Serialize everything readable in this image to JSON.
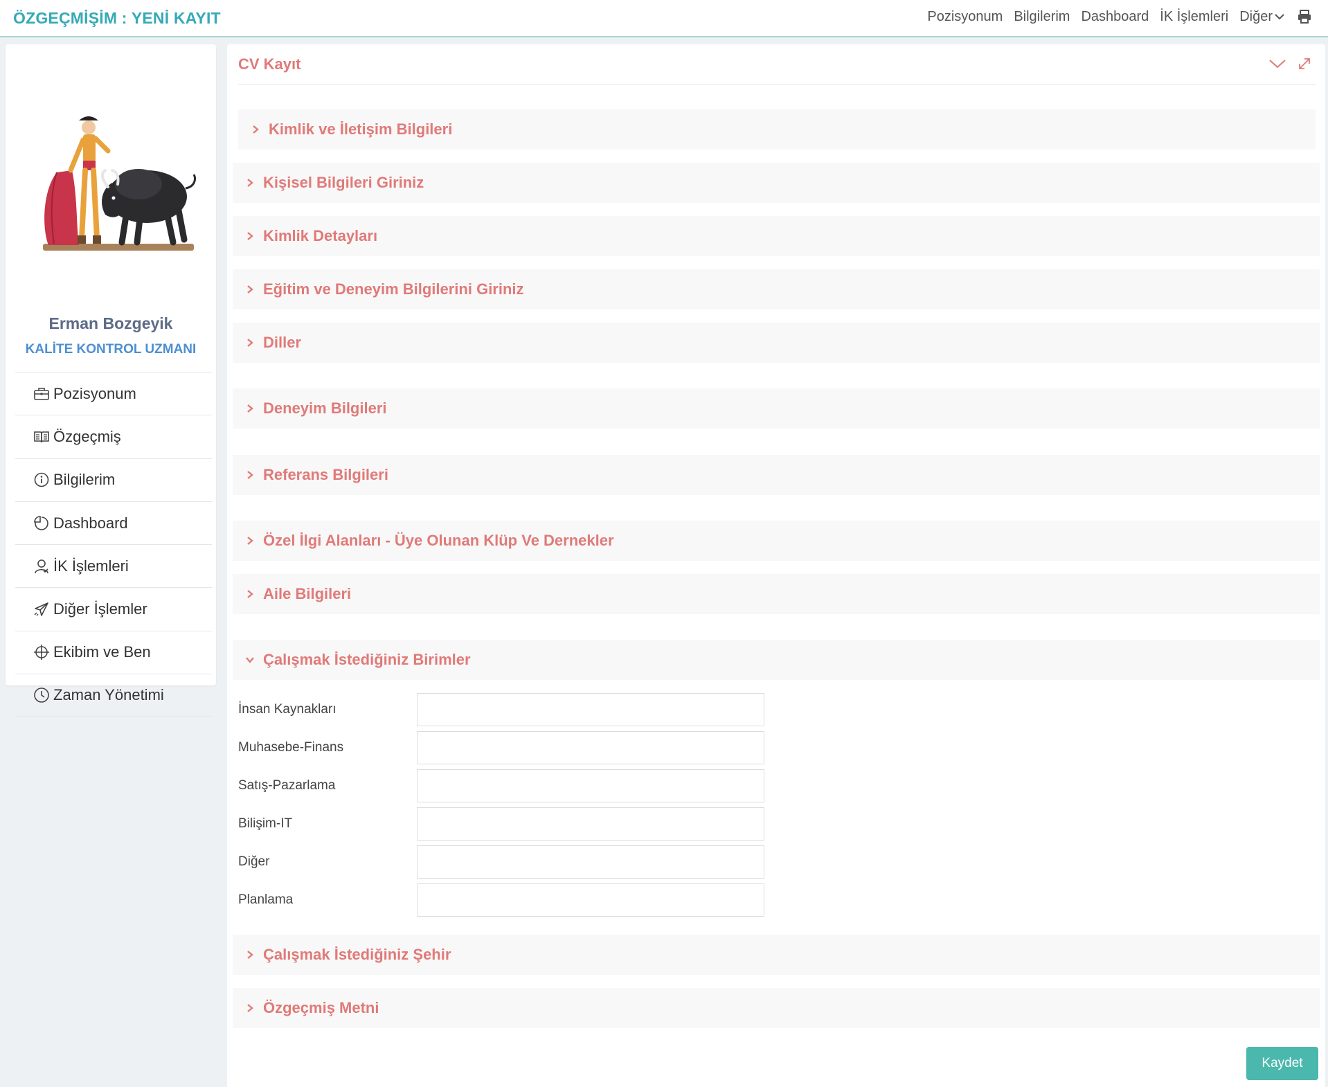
{
  "header": {
    "brand": "ÖZGEÇMİŞİM : YENİ KAYIT",
    "nav": [
      "Pozisyonum",
      "Bilgilerim",
      "Dashboard",
      "İK İşlemleri"
    ],
    "more_label": "Diğer",
    "print_icon": "printer-icon"
  },
  "colors": {
    "brand": "#36a9b7",
    "accent": "#e07a78",
    "user_name": "#5c6b87",
    "user_title": "#4d8fd0",
    "save_button": "#4bb8ad"
  },
  "profile": {
    "name": "Erman Bozgeyik",
    "title": "KALİTE KONTROL UZMANI",
    "avatar": "matador-bull-illustration"
  },
  "sidebar": {
    "items": [
      {
        "label": "Pozisyonum",
        "icon": "briefcase-icon"
      },
      {
        "label": "Özgeçmiş",
        "icon": "book-icon"
      },
      {
        "label": "Bilgilerim",
        "icon": "info-icon"
      },
      {
        "label": "Dashboard",
        "icon": "pie-chart-icon"
      },
      {
        "label": "İK İşlemleri",
        "icon": "user-icon"
      },
      {
        "label": "Diğer İşlemler",
        "icon": "plane-icon"
      },
      {
        "label": "Ekibim ve Ben",
        "icon": "target-icon"
      },
      {
        "label": "Zaman Yönetimi",
        "icon": "clock-icon"
      }
    ]
  },
  "panel": {
    "title": "CV Kayıt",
    "tools": [
      "collapse-icon",
      "expand-icon"
    ]
  },
  "sections": [
    {
      "label": "Kimlik ve İletişim Bilgileri",
      "expanded": false
    },
    {
      "label": "Kişisel Bilgileri Giriniz",
      "expanded": false
    },
    {
      "label": "Kimlik Detayları",
      "expanded": false
    },
    {
      "label": "Eğitim ve Deneyim Bilgilerini Giriniz",
      "expanded": false
    },
    {
      "label": "Diller",
      "expanded": false
    },
    {
      "label": "Deneyim Bilgileri",
      "expanded": false
    },
    {
      "label": "Referans Bilgileri",
      "expanded": false
    },
    {
      "label": "Özel İlgi Alanları - Üye Olunan Klüp Ve Dernekler",
      "expanded": false
    },
    {
      "label": "Aile Bilgileri",
      "expanded": false
    },
    {
      "label": "Çalışmak İstediğiniz Birimler",
      "expanded": true
    },
    {
      "label": "Çalışmak İstediğiniz Şehir",
      "expanded": false
    },
    {
      "label": "Özgeçmiş Metni",
      "expanded": false
    }
  ],
  "units_form": {
    "fields": [
      {
        "label": "İnsan Kaynakları",
        "value": ""
      },
      {
        "label": "Muhasebe-Finans",
        "value": ""
      },
      {
        "label": "Satış-Pazarlama",
        "value": ""
      },
      {
        "label": "Bilişim-IT",
        "value": ""
      },
      {
        "label": "Diğer",
        "value": ""
      },
      {
        "label": "Planlama",
        "value": ""
      }
    ]
  },
  "actions": {
    "save_label": "Kaydet"
  }
}
